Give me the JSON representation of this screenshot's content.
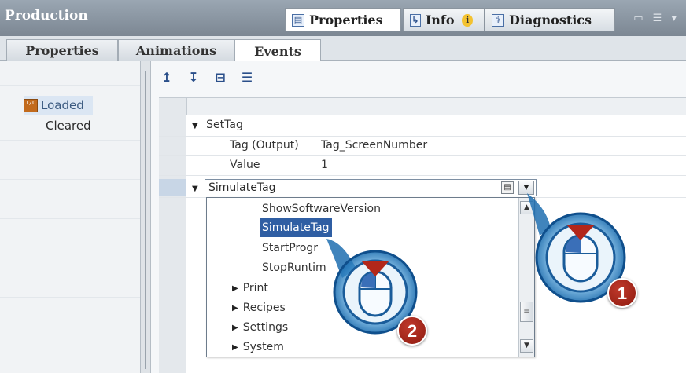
{
  "titlebar": {
    "title": "Production",
    "tabs": [
      {
        "label": "Properties",
        "icon": "properties-icon"
      },
      {
        "label": "Info",
        "icon": "info-icon"
      },
      {
        "label": "Diagnostics",
        "icon": "diagnostics-icon"
      }
    ],
    "info_badge": "i"
  },
  "subtabs": [
    "Properties",
    "Animations",
    "Events"
  ],
  "events": [
    {
      "label": "Loaded",
      "selected": true,
      "icon": "event-io-icon"
    },
    {
      "label": "Cleared",
      "selected": false
    }
  ],
  "event_icon_text": "I/O",
  "toolbar": {
    "icons": [
      "move-up-icon",
      "move-down-icon",
      "collapse-icon",
      "expand-icon"
    ],
    "glyphs": [
      "↥",
      "↧",
      "⊟",
      "☰"
    ]
  },
  "grid": {
    "rows": [
      {
        "expander": "▼",
        "label": "SetTag",
        "value": ""
      },
      {
        "label": "Tag (Output)",
        "value": "Tag_ScreenNumber"
      },
      {
        "label": "Value",
        "value": "1"
      }
    ],
    "combo": {
      "expander": "▼",
      "value": "SimulateTag",
      "list_icon": "▤",
      "drop_icon": "▼"
    }
  },
  "dropdown": {
    "items": [
      {
        "label": "ShowSoftwareVersion",
        "selected": false
      },
      {
        "label": "SimulateTag",
        "selected": true
      },
      {
        "label": "StartProgr",
        "selected": false
      },
      {
        "label": "StopRuntim",
        "selected": false
      }
    ],
    "groups": [
      "Print",
      "Recipes",
      "Settings",
      "System"
    ],
    "group_arrow": "▶",
    "scroll_up": "▲",
    "scroll_down": "▼",
    "scroll_thumb": "≡"
  },
  "callouts": [
    {
      "number": "1"
    },
    {
      "number": "2"
    }
  ],
  "colors": {
    "selection": "#2f5ea3",
    "badge": "#b3271a",
    "titlebar": "#8994a0"
  }
}
